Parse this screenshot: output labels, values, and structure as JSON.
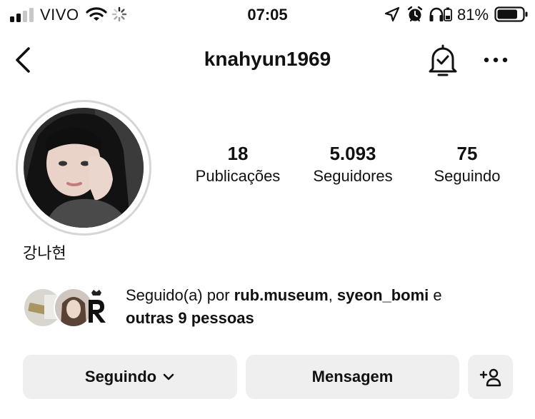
{
  "status_bar": {
    "carrier": "VIVO",
    "time": "07:05",
    "battery": "81%",
    "battery_level": 0.81,
    "icons": [
      "signal-icon",
      "wifi-icon",
      "loading-spinner-icon",
      "location-arrow-icon",
      "alarm-icon",
      "headphones-icon",
      "battery-icon"
    ]
  },
  "header": {
    "username": "knahyun1969",
    "icons": [
      "back-chevron-icon",
      "notification-bell-check-icon",
      "more-dots-icon"
    ]
  },
  "profile": {
    "display_name": "강나현",
    "stats": [
      {
        "value": "18",
        "label": "Publicações"
      },
      {
        "value": "5.093",
        "label": "Seguidores"
      },
      {
        "value": "75",
        "label": "Seguindo"
      }
    ]
  },
  "followed_by": {
    "prefix": "Seguido(a) por ",
    "user1": "rub.museum",
    "sep": ", ",
    "user2": "syeon_bomi",
    "conj": " e",
    "others": "outras 9 pessoas"
  },
  "actions": {
    "following_label": "Seguindo",
    "message_label": "Mensagem",
    "icons": [
      "chevron-down-icon",
      "add-person-icon"
    ]
  },
  "colors": {
    "text": "#111111",
    "button_bg": "#efefef",
    "ring": "#d6d6d6"
  }
}
